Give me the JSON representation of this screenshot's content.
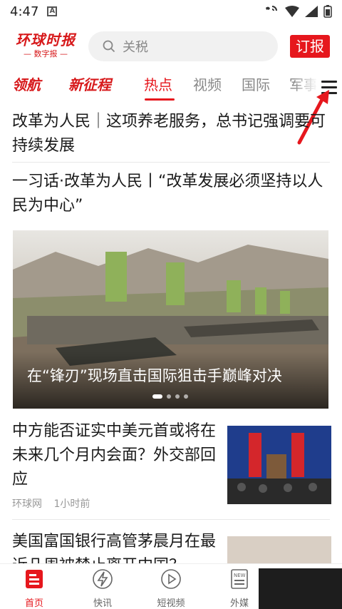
{
  "status_bar": {
    "time": "4:47",
    "badge": "A"
  },
  "header": {
    "logo_main": "环球时报",
    "logo_sub": "— 数字报 —",
    "search_placeholder": "关税",
    "subscribe_label": "订报"
  },
  "tabs": [
    {
      "label": "领航"
    },
    {
      "label": "新征程"
    },
    {
      "label": "热点"
    },
    {
      "label": "视频"
    },
    {
      "label": "国际"
    },
    {
      "label": "军事"
    }
  ],
  "feed": {
    "headline_1": "改革为人民｜这项养老服务，总书记强调要可持续发展",
    "headline_2": "一习话·改革为人民丨“改革发展必须坚持以人民为中心”",
    "banner_caption": "在“锋刃”现场直击国际狙击手巅峰对决",
    "news_1": {
      "title": "中方能否证实中美元首或将在未来几个月内会面？外交部回应",
      "source": "环球网",
      "time": "1小时前"
    },
    "news_2": {
      "title": "美国富国银行高管茅晨月在最近几周被禁止离开中国？"
    }
  },
  "bottom_nav": [
    {
      "label": "首页"
    },
    {
      "label": "快讯"
    },
    {
      "label": "短视频"
    },
    {
      "label": "外媒"
    }
  ],
  "colors": {
    "accent": "#e6171d",
    "brand_red": "#d7191b"
  }
}
